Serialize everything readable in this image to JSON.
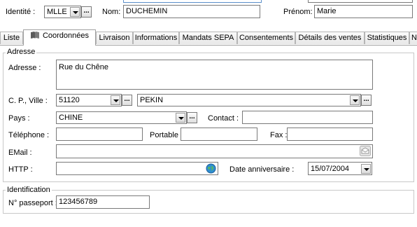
{
  "header": {
    "identite_label": "Identité :",
    "identite_value": "MLLE",
    "nom_label": "Nom:",
    "nom_value": "DUCHEMIN",
    "prenom_label": "Prénom:",
    "prenom_value": "Marie"
  },
  "tabs": [
    {
      "label": "Liste"
    },
    {
      "label": "Coordonnées",
      "icon": "book-icon",
      "active": true
    },
    {
      "label": "Livraison"
    },
    {
      "label": "Informations"
    },
    {
      "label": "Mandats SEPA"
    },
    {
      "label": "Consentements"
    },
    {
      "label": "Détails des ventes"
    },
    {
      "label": "Statistiques"
    },
    {
      "label": "N"
    }
  ],
  "adresse_group": {
    "title": "Adresse",
    "adresse_label": "Adresse :",
    "adresse_value": "Rue du Chêne",
    "cp_ville_label": "C. P., Ville :",
    "cp_value": "51120",
    "ville_value": "PEKIN",
    "pays_label": "Pays :",
    "pays_value": "CHINE",
    "contact_label": "Contact :",
    "contact_value": "",
    "telephone_label": "Téléphone :",
    "telephone_value": "",
    "portable_label": "Portable :",
    "portable_value": "",
    "fax_label": "Fax :",
    "fax_value": "",
    "email_label": "EMail :",
    "email_value": "",
    "http_label": "HTTP :",
    "http_value": "",
    "anniversaire_label": "Date anniversaire :",
    "anniversaire_value": "15/07/2004"
  },
  "identification_group": {
    "title": "Identification",
    "passeport_label": "N° passeport :",
    "passeport_value": "123456789"
  },
  "ellipsis": "...",
  "colors": {
    "globe": "#2f8fd0",
    "border": "#7a7a7a",
    "group_border": "#c8c8c8"
  }
}
